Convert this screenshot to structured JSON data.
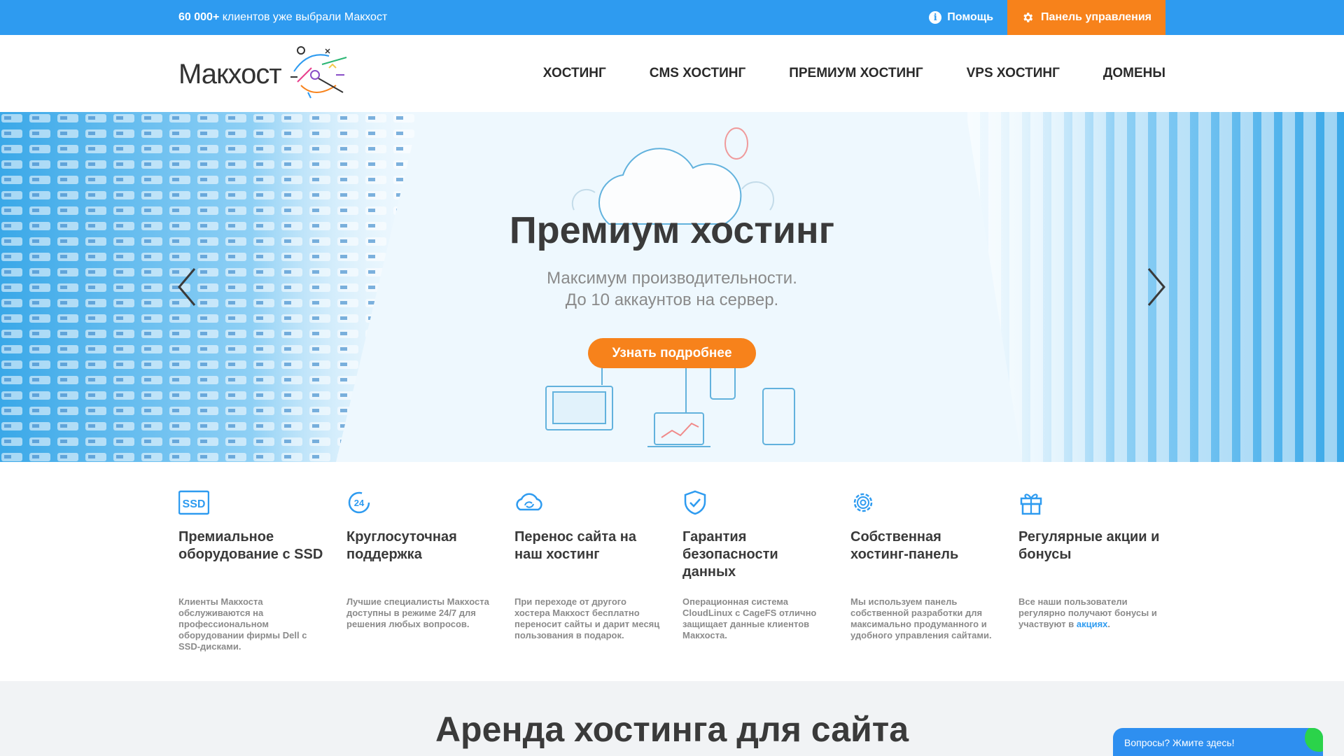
{
  "topbar": {
    "clients_bold": "60 000+",
    "clients_rest": " клиентов уже выбрали Макхост",
    "help_label": "Помощь",
    "panel_label": "Панель управления"
  },
  "header": {
    "logo_text": "Макхост",
    "nav": [
      "Хостинг",
      "CMS хостинг",
      "Премиум хостинг",
      "VPS хостинг",
      "Домены"
    ]
  },
  "hero": {
    "title": "Премиум хостинг",
    "subtitle_line1": "Максимум производительности.",
    "subtitle_line2": "До 10 аккаунтов на сервер.",
    "button_label": "Узнать подробнее"
  },
  "features": [
    {
      "icon": "ssd-icon",
      "title": "Премиальное оборудование с SSD",
      "text": "Клиенты Макхоста обслуживаются на профессиональном оборудовании фирмы Dell с SSD-дисками."
    },
    {
      "icon": "support-24-icon",
      "title": "Круглосуточная поддержка",
      "text": "Лучшие специалисты Макхоста доступны в режиме 24/7 для решения любых вопросов."
    },
    {
      "icon": "cloud-transfer-icon",
      "title": "Перенос сайта на наш хостинг",
      "text": "При переходе от другого хостера Макхост бесплатно переносит сайты и дарит месяц пользования в подарок."
    },
    {
      "icon": "shield-check-icon",
      "title": "Гарантия безопасности данных",
      "text": "Операционная система CloudLinux с CageFS отлично защищает данные клиентов Макхоста."
    },
    {
      "icon": "gear-icon",
      "title": "Собственная хостинг-панель",
      "text": "Мы используем панель собственной разработки для максимально продуманного и удобного управления сайтами."
    },
    {
      "icon": "gift-icon",
      "title": "Регулярные акции и бонусы",
      "text": "Все наши пользователи регулярно получают бонусы и участвуют в ",
      "link": "акциях",
      "tail": "."
    }
  ],
  "section": {
    "title": "Аренда хостинга для сайта"
  },
  "chat": {
    "label": "Вопросы? Жмите здесь!"
  },
  "colors": {
    "topbar": "#2e9bf0",
    "accent": "#f7821b",
    "link": "#2e9bf0"
  }
}
